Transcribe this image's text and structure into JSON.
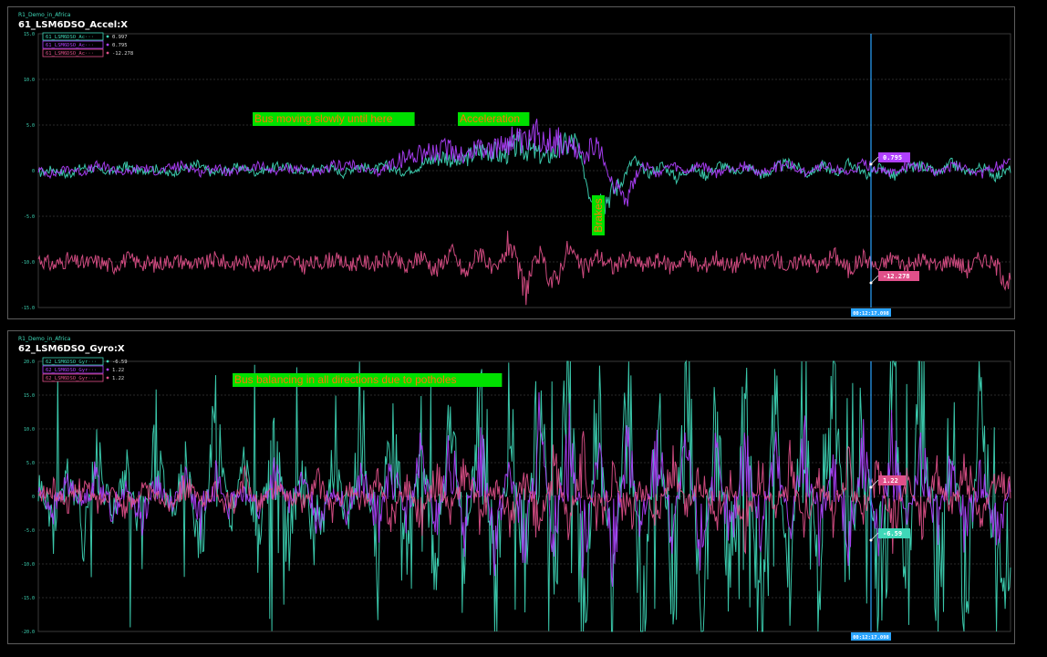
{
  "panels": [
    {
      "pretitle": "R1_Demo_in_Africa",
      "title": "61_LSM6DSO_Accel:X",
      "cursor_time": "00:12:17.098",
      "colors": {
        "axis": "#3fd8b8",
        "cursor": "#2aa4ff"
      },
      "value_labels": [
        {
          "text": "0.795",
          "color": "#b040ff"
        },
        {
          "text": "-12.278",
          "color": "#e0508a"
        }
      ],
      "annotations": [
        {
          "text": "Bus moving slowly until here"
        },
        {
          "text": "Acceleration"
        },
        {
          "text": "Brakes"
        }
      ]
    },
    {
      "pretitle": "R1_Demo_in_Africa",
      "title": "62_LSM6DSO_Gyro:X",
      "cursor_time": "00:12:17.098",
      "colors": {
        "axis": "#3fd8b8",
        "cursor": "#2aa4ff"
      },
      "value_labels": [
        {
          "text": "1.22",
          "color": "#e0508a"
        },
        {
          "text": "-6.59",
          "color": "#3fd8b8"
        }
      ],
      "annotations": [
        {
          "text": "Bus balancing in all directions due to potholes"
        }
      ]
    }
  ],
  "chart_data": [
    {
      "type": "line",
      "title": "61_LSM6DSO_Accel:X",
      "ylim": [
        -15,
        15
      ],
      "yticks": [
        "15.0",
        "10.0",
        "5.0",
        "0",
        "-5.0",
        "-10.0",
        "-15.0"
      ],
      "grid": true,
      "legend_placement": "top-left",
      "series": [
        {
          "name": "61_LSM6DSO_Ac···",
          "value": "0.997",
          "color": "#3fd8b8",
          "values": [
            -0.3,
            0.2,
            -0.5,
            0.4,
            0.1,
            -0.2,
            0.5,
            -0.1,
            0.3,
            -0.4,
            0.2,
            0.6,
            -0.3,
            0.1,
            0.4,
            -0.2,
            0.3,
            0.5,
            -0.1,
            0.2,
            0.4,
            -0.3,
            0.6,
            0.1,
            0.5,
            -0.2,
            0.3,
            1.2,
            1.6,
            0.8,
            1.9,
            2.4,
            1.5,
            2.8,
            2.1,
            1.4,
            2.6,
            3.2,
            -2.4,
            -3.2,
            -1.6,
            1.2,
            -0.4,
            0.6,
            -0.8,
            0.3,
            -0.5,
            0.7,
            -0.2,
            0.4,
            -0.6,
            0.5,
            0.8,
            -0.4,
            0.6,
            -0.3,
            0.9,
            -0.5,
            0.4,
            -0.7,
            0.3,
            0.6,
            -0.4,
            0.8,
            -0.3,
            0.5,
            -0.6,
            0.2
          ]
        },
        {
          "name": "61_LSM6DSO_Ac···",
          "value": "0.795",
          "color": "#b040ff",
          "values": [
            0.1,
            -0.4,
            0.3,
            -0.2,
            0.5,
            0.2,
            -0.3,
            0.4,
            -0.1,
            0.3,
            0.6,
            -0.2,
            0.4,
            -0.3,
            0.2,
            0.5,
            -0.1,
            0.3,
            0.2,
            -0.4,
            0.5,
            0.7,
            0.2,
            -0.3,
            0.8,
            1.4,
            2.2,
            1.8,
            2.6,
            1.5,
            2.9,
            2.2,
            3.6,
            2.7,
            4.1,
            3.4,
            2.5,
            1.8,
            2.6,
            -1.5,
            -2.6,
            0.8,
            -0.3,
            0.5,
            -0.2,
            0.6,
            -0.4,
            0.3,
            0.5,
            -0.3,
            0.4,
            0.6,
            -0.2,
            0.5,
            0.3,
            -0.4,
            0.7,
            0.2,
            -0.3,
            0.5,
            0.4,
            -0.2,
            0.6,
            0.3,
            -0.4,
            0.5,
            0.795
          ]
        },
        {
          "name": "61_LSM6DSO_Ac···",
          "value": "-12.278",
          "color": "#e0508a",
          "values": [
            -9.6,
            -10.4,
            -9.8,
            -10.2,
            -9.9,
            -10.5,
            -9.7,
            -10.1,
            -10.3,
            -9.8,
            -10.0,
            -10.4,
            -9.7,
            -10.2,
            -9.9,
            -10.3,
            -10.0,
            -9.8,
            -10.4,
            -10.1,
            -9.7,
            -10.3,
            -10.0,
            -10.2,
            -9.5,
            -10.8,
            -9.2,
            -11.0,
            -8.8,
            -11.5,
            -8.5,
            -11.8,
            -7.6,
            -13.2,
            -9.1,
            -12.6,
            -8.4,
            -10.9,
            -9.3,
            -10.6,
            -9.6,
            -10.4,
            -9.8,
            -10.5,
            -9.4,
            -10.7,
            -9.5,
            -10.6,
            -9.6,
            -10.3,
            -9.4,
            -10.8,
            -9.3,
            -10.6,
            -9.2,
            -10.9,
            -9.5,
            -10.7,
            -9.4,
            -10.6,
            -9.7,
            -10.5,
            -9.6,
            -10.8,
            -9.5,
            -10.4,
            -12.278
          ]
        }
      ]
    },
    {
      "type": "line",
      "title": "62_LSM6DSO_Gyro:X",
      "ylim": [
        -20,
        20
      ],
      "yticks": [
        "20.0",
        "15.0",
        "10.0",
        "5.0",
        "0",
        "-5.0",
        "-10.0",
        "-15.0",
        "-20.0"
      ],
      "grid": true,
      "legend_placement": "top-left",
      "series": [
        {
          "name": "62_LSM6DSO_Gyr···",
          "value": "-6.59",
          "color": "#3fd8b8",
          "values": [
            2,
            -3,
            4,
            -5,
            6,
            -2,
            3,
            -6,
            8,
            -4,
            5,
            -7,
            9,
            -3,
            4,
            -6,
            7,
            -5,
            3,
            -8,
            6,
            -4,
            9,
            -10,
            12,
            -6,
            8,
            -11,
            10,
            -7,
            13,
            -15,
            11,
            -9,
            14,
            -12,
            18,
            -16,
            12,
            -14,
            17,
            -18,
            15,
            -13,
            19,
            -17,
            14,
            -15,
            16,
            -19,
            13,
            -12,
            18,
            -14,
            20,
            -16,
            15,
            -18,
            17,
            -13,
            19,
            -15,
            14,
            -17,
            16,
            -12,
            -6.59
          ]
        },
        {
          "name": "62_LSM6DSO_Gyr···",
          "value": "1.22",
          "color": "#b040ff",
          "values": [
            1,
            -2,
            2,
            -1,
            3,
            -2,
            1,
            -3,
            2,
            -1,
            2,
            -3,
            3,
            -2,
            1,
            -2,
            3,
            -1,
            2,
            -3,
            1,
            -2,
            3,
            -4,
            4,
            -3,
            5,
            -4,
            6,
            -5,
            7,
            -6,
            5,
            -7,
            8,
            -6,
            9,
            -7,
            6,
            -8,
            7,
            -6,
            8,
            -5,
            6,
            -7,
            5,
            -6,
            7,
            -5,
            6,
            -4,
            7,
            -6,
            5,
            -7,
            6,
            -5,
            7,
            -4,
            6,
            -5,
            5,
            -6,
            4,
            -5,
            1.22
          ]
        },
        {
          "name": "62_LSM6DSO_Gyr···",
          "value": "1.22",
          "color": "#e0508a",
          "values": [
            0,
            1,
            -1,
            2,
            -1,
            1,
            -2,
            1,
            0,
            -1,
            2,
            -1,
            1,
            -2,
            2,
            -1,
            1,
            0,
            -1,
            2,
            -2,
            1,
            -1,
            2,
            -3,
            2,
            -3,
            3,
            -2,
            4,
            -3,
            2,
            -4,
            3,
            -5,
            4,
            -3,
            5,
            -4,
            3,
            -4,
            2,
            -3,
            4,
            -2,
            3,
            -3,
            2,
            -4,
            3,
            -2,
            4,
            -3,
            2,
            -3,
            4,
            -2,
            3,
            -4,
            2,
            -3,
            3,
            -2,
            4,
            -3,
            2,
            1.22
          ]
        }
      ]
    }
  ]
}
